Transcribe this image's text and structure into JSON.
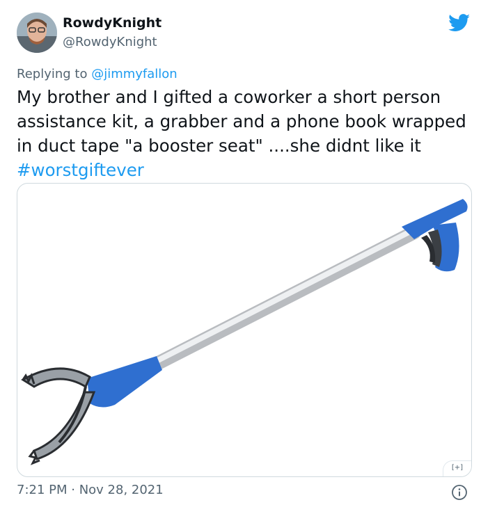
{
  "tweet": {
    "display_name": "RowdyKnight",
    "handle": "@RowdyKnight",
    "reply_prefix": "Replying to ",
    "reply_to": "@jimmyfallon",
    "text_main": "My brother and I gifted a coworker a short person assistance kit, a grabber and a phone book wrapped in duct tape \"a booster seat\" ....she didnt like it ",
    "hashtag": "#worstgiftever",
    "media_badge": "[+]",
    "timestamp": "7:21 PM · Nov 28, 2021"
  },
  "icons": {
    "brand": "twitter-bird-icon",
    "info": "info-icon"
  },
  "colors": {
    "accent": "#1d9bf0",
    "text": "#0f1419",
    "muted": "#536471",
    "grabber_blue": "#2f6fd0"
  }
}
